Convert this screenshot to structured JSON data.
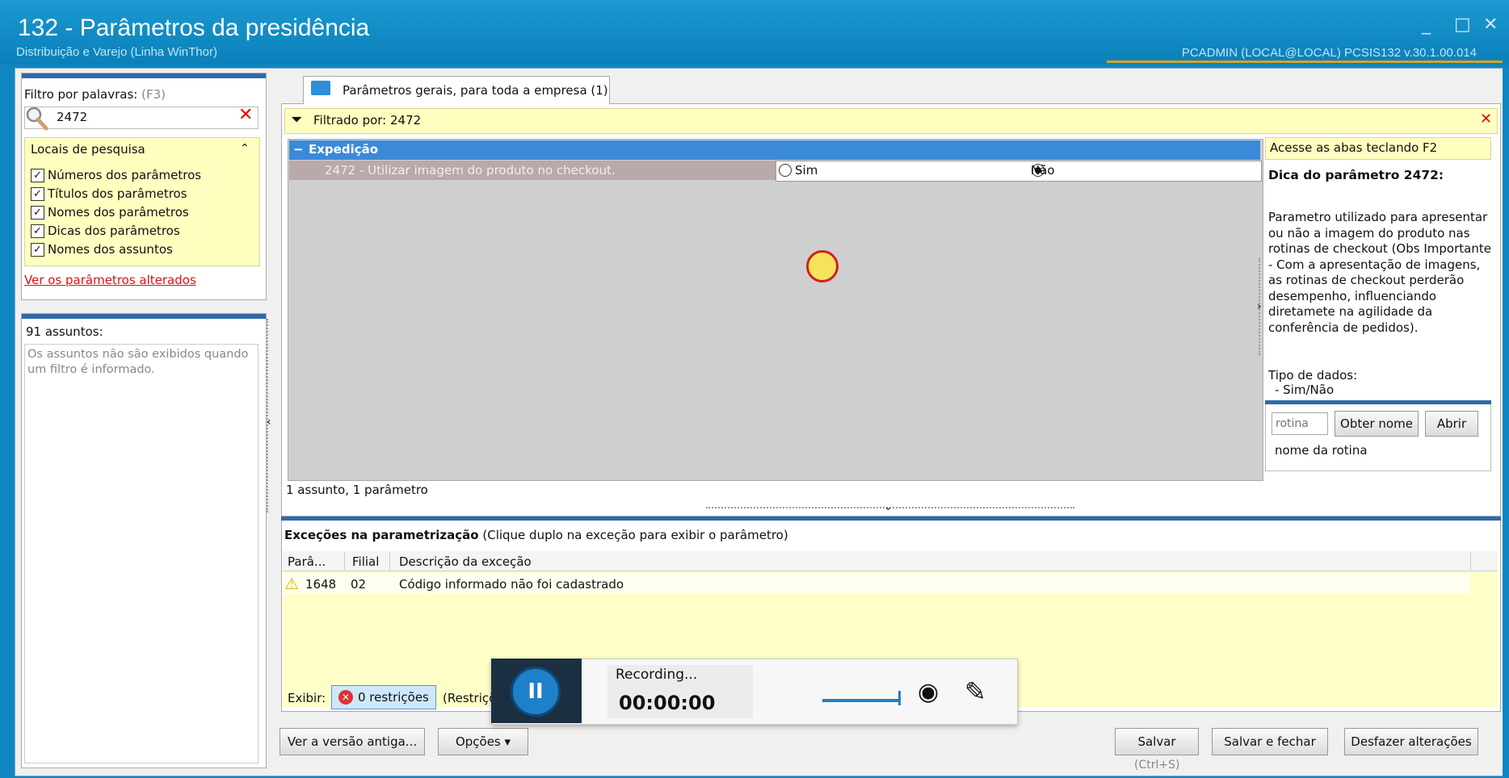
{
  "window": {
    "title": "132 - Parâmetros da presidência",
    "subtitle": "Distribuição e Varejo (Linha WinThor)",
    "user_info": "PCADMIN (LOCAL@LOCAL)   PCSIS132  v.30.1.00.014",
    "controls": {
      "minimize": "_",
      "maximize": "□",
      "close": "✕"
    }
  },
  "filter": {
    "label": "Filtro por palavras:",
    "hint": "(F3)",
    "value": "2472",
    "clear_icon": "✕",
    "locais_title": "Locais de pesquisa",
    "locais_chevron": "⌃",
    "options": [
      {
        "label": "Números dos parâmetros",
        "checked": true
      },
      {
        "label": "Títulos dos parâmetros",
        "checked": true
      },
      {
        "label": "Nomes dos parâmetros",
        "checked": true
      },
      {
        "label": "Dicas dos parâmetros",
        "checked": true
      },
      {
        "label": "Nomes dos assuntos",
        "checked": true
      }
    ],
    "check_mark": "✓",
    "altered_link": "Ver os parâmetros alterados"
  },
  "assuntos": {
    "title": "91 assuntos:",
    "note": "Os assuntos não são exibidos quando um filtro é informado."
  },
  "tab": {
    "label": "Parâmetros gerais, para toda a empresa  (1)"
  },
  "filtered": {
    "text": "Filtrado por: 2472",
    "close": "✕",
    "icon": "⏷"
  },
  "grid": {
    "group_minus": "−",
    "group_label": "Expedição",
    "param_label": "2472 - Utilizar imagem do produto no checkout.",
    "option_sim": "Sim",
    "option_nao": "Não",
    "selected": "Não",
    "status": "1 assunto, 1 parâmetro"
  },
  "hint": {
    "bar": "Acesse as abas teclando F2",
    "title": "Dica do parâmetro 2472:",
    "body": "Parametro utilizado para apresentar ou não a imagem do produto nas rotinas de checkout (Obs Importante - Com a apresentação de imagens, as rotinas de checkout perderão desempenho, influenciando diretamete na agilidade da conferência de pedidos).",
    "type_label": "Tipo de dados:",
    "type_value": "- Sim/Não"
  },
  "routine": {
    "placeholder": "rotina",
    "obter_label": "Obter nome",
    "abrir_label": "Abrir",
    "caption": "nome da rotina"
  },
  "exceptions": {
    "title": "Exceções na parametrização",
    "subtitle": "  (Clique duplo na exceção para exibir o parâmetro)",
    "columns": [
      "Parâ...",
      "Filial",
      "Descrição da exceção"
    ],
    "rows": [
      {
        "param": "1648",
        "filial": "02",
        "descricao": "Código informado não foi cadastrado"
      }
    ],
    "exibir_label": "Exibir:",
    "restr_label": "0 restrições",
    "restr_icon": "✕",
    "restr_tail": "(Restriçõ"
  },
  "footer": {
    "antiga_label": "Ver a versão antiga...",
    "opcoes_label": "Opções ▾",
    "salvar_label": "Salvar",
    "salvar_shortcut": "(Ctrl+S)",
    "salvar_fechar_label": "Salvar e fechar",
    "desfazer_label": "Desfazer alterações"
  },
  "recorder": {
    "pause_icon": "II",
    "status": "Recording...",
    "time": "00:00:00",
    "cam_icon": "◉",
    "pen_icon": "✎"
  },
  "icons": {
    "search": "search-icon",
    "warning": "⚠",
    "collapse_left": "‹",
    "collapse_right": "›",
    "split_down": "⌄"
  },
  "colors": {
    "titlebar": "#0f86c0",
    "accent_blue": "#2e6aa8",
    "highlight_yellow": "#ffffc0",
    "error_red": "#dd1111"
  }
}
